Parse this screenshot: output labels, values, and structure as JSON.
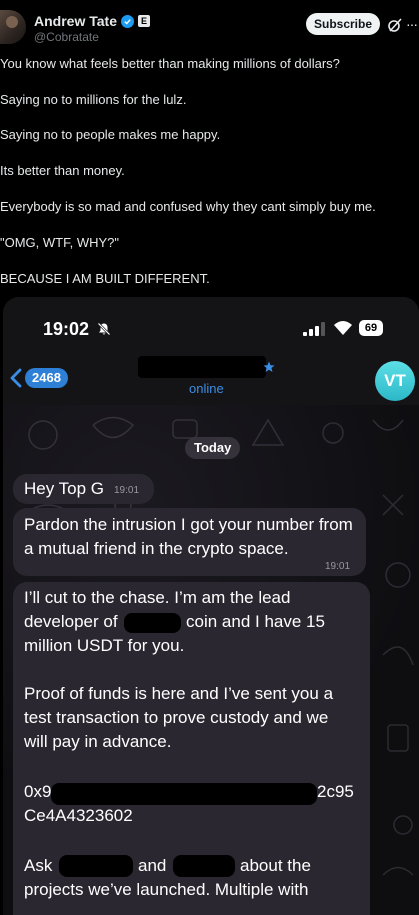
{
  "tweet": {
    "display_name": "Andrew Tate",
    "handle": "@Cobratate",
    "affiliation_badge": "E",
    "subscribe_label": "Subscribe",
    "more_label": "···",
    "lines": [
      "You know what feels better than making millions of dollars?",
      "Saying no to millions for the lulz.",
      "Saying no to people makes me happy.",
      "Its better than money.",
      "Everybody is so mad and confused why they cant simply buy me.",
      "\"OMG, WTF, WHY?\"",
      "BECAUSE I AM BUILT DIFFERENT."
    ]
  },
  "screenshot": {
    "status_bar": {
      "time": "19:02",
      "battery": "69"
    },
    "chat_header": {
      "back_count": "2468",
      "contact_status": "online",
      "avatar_initials": "VT"
    },
    "date_chip": "Today",
    "messages": [
      {
        "text": "Hey Top G",
        "time": "19:01"
      },
      {
        "text": "Pardon the intrusion I got your number from a mutual friend in the crypto space.",
        "time": "19:01"
      }
    ],
    "long_message": {
      "line1": "I’ll cut to the chase. I’m am the lead",
      "line2a": "developer of",
      "line2b": "coin and I have 15",
      "line3": "million USDT for you.",
      "line4": "Proof of funds is here and I’ve sent you a",
      "line5": "test transaction to prove custody and we",
      "line6": "will pay in advance.",
      "addr_start": "0x9",
      "addr_end": "2c95",
      "addr_line2": "Ce4A4323602",
      "line8a": "Ask",
      "line8b": "and",
      "line8c": "about the",
      "line9": "projects we’ve launched. Multiple with"
    }
  }
}
